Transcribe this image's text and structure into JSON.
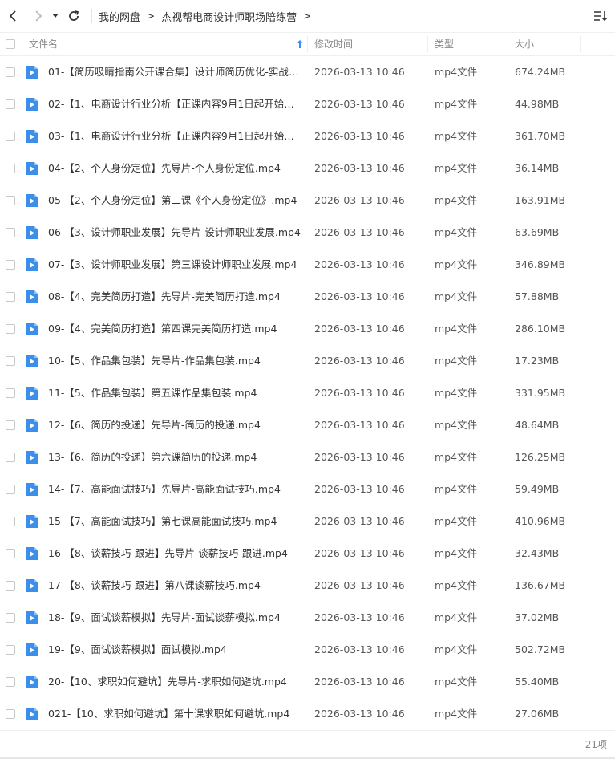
{
  "breadcrumb": [
    "我的网盘",
    "杰视帮电商设计师职场陪练营"
  ],
  "breadcrumb_sep": ">",
  "columns": {
    "name": "文件名",
    "modified": "修改时间",
    "type": "类型",
    "size": "大小"
  },
  "colors": {
    "file_icon": "#3b8fe8",
    "sort_arrow": "#3b8fe8"
  },
  "files": [
    {
      "name": "01-【简历吸睛指南公开课合集】设计师简历优化-实战分享.mp4",
      "modified": "2026-03-13 10:46",
      "type": "mp4文件",
      "size": "674.24MB"
    },
    {
      "name": "02-【1、电商设计行业分析【正课内容9月1日起开始更新】先导片.mp4",
      "modified": "2026-03-13 10:46",
      "type": "mp4文件",
      "size": "44.98MB"
    },
    {
      "name": "03-【1、电商设计行业分析【正课内容9月1日起开始更新】第一课.mp4",
      "modified": "2026-03-13 10:46",
      "type": "mp4文件",
      "size": "361.70MB"
    },
    {
      "name": "04-【2、个人身份定位】先导片-个人身份定位.mp4",
      "modified": "2026-03-13 10:46",
      "type": "mp4文件",
      "size": "36.14MB"
    },
    {
      "name": "05-【2、个人身份定位】第二课《个人身份定位》.mp4",
      "modified": "2026-03-13 10:46",
      "type": "mp4文件",
      "size": "163.91MB"
    },
    {
      "name": "06-【3、设计师职业发展】先导片-设计师职业发展.mp4",
      "modified": "2026-03-13 10:46",
      "type": "mp4文件",
      "size": "63.69MB"
    },
    {
      "name": "07-【3、设计师职业发展】第三课设计师职业发展.mp4",
      "modified": "2026-03-13 10:46",
      "type": "mp4文件",
      "size": "346.89MB"
    },
    {
      "name": "08-【4、完美简历打造】先导片-完美简历打造.mp4",
      "modified": "2026-03-13 10:46",
      "type": "mp4文件",
      "size": "57.88MB"
    },
    {
      "name": "09-【4、完美简历打造】第四课完美简历打造.mp4",
      "modified": "2026-03-13 10:46",
      "type": "mp4文件",
      "size": "286.10MB"
    },
    {
      "name": "10-【5、作品集包装】先导片-作品集包装.mp4",
      "modified": "2026-03-13 10:46",
      "type": "mp4文件",
      "size": "17.23MB"
    },
    {
      "name": "11-【5、作品集包装】第五课作品集包装.mp4",
      "modified": "2026-03-13 10:46",
      "type": "mp4文件",
      "size": "331.95MB"
    },
    {
      "name": "12-【6、简历的投递】先导片-简历的投递.mp4",
      "modified": "2026-03-13 10:46",
      "type": "mp4文件",
      "size": "48.64MB"
    },
    {
      "name": "13-【6、简历的投递】第六课简历的投递.mp4",
      "modified": "2026-03-13 10:46",
      "type": "mp4文件",
      "size": "126.25MB"
    },
    {
      "name": "14-【7、高能面试技巧】先导片-高能面试技巧.mp4",
      "modified": "2026-03-13 10:46",
      "type": "mp4文件",
      "size": "59.49MB"
    },
    {
      "name": "15-【7、高能面试技巧】第七课高能面试技巧.mp4",
      "modified": "2026-03-13 10:46",
      "type": "mp4文件",
      "size": "410.96MB"
    },
    {
      "name": "16-【8、谈薪技巧-跟进】先导片-谈薪技巧-跟进.mp4",
      "modified": "2026-03-13 10:46",
      "type": "mp4文件",
      "size": "32.43MB"
    },
    {
      "name": "17-【8、谈薪技巧-跟进】第八课谈薪技巧.mp4",
      "modified": "2026-03-13 10:46",
      "type": "mp4文件",
      "size": "136.67MB"
    },
    {
      "name": "18-【9、面试谈薪模拟】先导片-面试谈薪模拟.mp4",
      "modified": "2026-03-13 10:46",
      "type": "mp4文件",
      "size": "37.02MB"
    },
    {
      "name": "19-【9、面试谈薪模拟】面试模拟.mp4",
      "modified": "2026-03-13 10:46",
      "type": "mp4文件",
      "size": "502.72MB"
    },
    {
      "name": "20-【10、求职如何避坑】先导片-求职如何避坑.mp4",
      "modified": "2026-03-13 10:46",
      "type": "mp4文件",
      "size": "55.40MB"
    },
    {
      "name": "021-【10、求职如何避坑】第十课求职如何避坑.mp4",
      "modified": "2026-03-13 10:46",
      "type": "mp4文件",
      "size": "27.06MB"
    }
  ],
  "footer": {
    "count": "21项"
  }
}
